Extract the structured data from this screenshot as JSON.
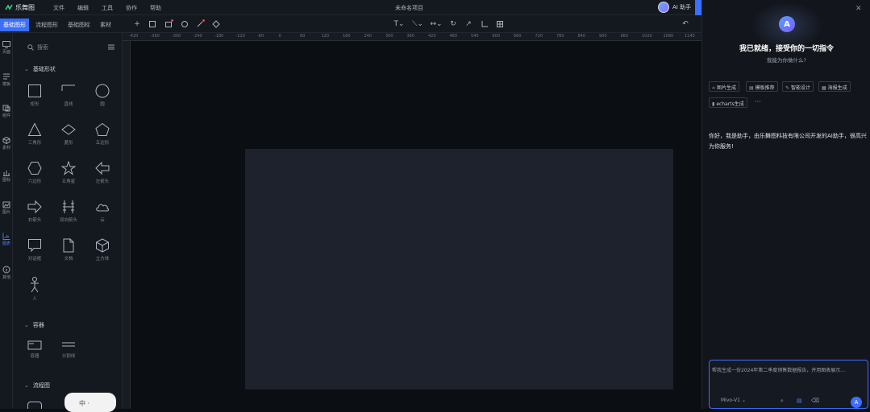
{
  "app": {
    "name": "乐舞图"
  },
  "menu": [
    "文件",
    "编辑",
    "工具",
    "协作",
    "帮助"
  ],
  "document": {
    "title": "未命名项目"
  },
  "ai_button": {
    "label": "AI 助手"
  },
  "tabs": [
    {
      "label": "基础图形",
      "active": true
    },
    {
      "label": "流程图形",
      "active": false
    },
    {
      "label": "基础图标",
      "active": false
    },
    {
      "label": "素材",
      "active": false
    }
  ],
  "toolbar": {
    "left_icons": [
      "plus-icon",
      "save-icon",
      "export-icon",
      "history-icon",
      "brush-icon",
      "fill-icon"
    ],
    "center_icons": [
      "text-icon",
      "line-icon",
      "arrow-style-icon",
      "rotate-icon",
      "pin-icon",
      "crop-icon",
      "grid-icon"
    ],
    "right_icons": [
      "undo-icon"
    ]
  },
  "rail": [
    {
      "label": "页面",
      "icon": "monitor-icon",
      "active": false
    },
    {
      "label": "模板",
      "icon": "document-icon",
      "active": false
    },
    {
      "label": "组件",
      "icon": "component-icon",
      "active": false
    },
    {
      "label": "素材",
      "icon": "cube-icon",
      "active": false
    },
    {
      "label": "图标",
      "icon": "chart-icon",
      "active": false
    },
    {
      "label": "图片",
      "icon": "image-icon",
      "active": false
    },
    {
      "label": "图表",
      "icon": "bar-chart-icon",
      "active": true
    },
    {
      "label": "其他",
      "icon": "info-icon",
      "active": false
    }
  ],
  "panel": {
    "search_placeholder": "搜索",
    "sections": [
      {
        "title": "基础形状",
        "shapes": [
          {
            "name": "rectangle-shape",
            "label": "矩形"
          },
          {
            "name": "line-shape",
            "label": "直线"
          },
          {
            "name": "circle-shape",
            "label": "圆"
          },
          {
            "name": "triangle-shape",
            "label": "三角形"
          },
          {
            "name": "diamond-shape",
            "label": "菱形"
          },
          {
            "name": "pentagon-shape",
            "label": "五边形"
          },
          {
            "name": "hexagon-shape",
            "label": "六边形"
          },
          {
            "name": "star-shape",
            "label": "五角星"
          },
          {
            "name": "left-arrow-shape",
            "label": "左箭头"
          },
          {
            "name": "right-arrow-shape",
            "label": "右箭头"
          },
          {
            "name": "double-arrow-shape",
            "label": "双向箭头"
          },
          {
            "name": "cloud-shape",
            "label": "云"
          },
          {
            "name": "callout-shape",
            "label": "对话框"
          },
          {
            "name": "document-shape",
            "label": "文档"
          },
          {
            "name": "cube-shape",
            "label": "立方体"
          },
          {
            "name": "person-shape",
            "label": "人"
          }
        ]
      },
      {
        "title": "容器",
        "shapes": [
          {
            "name": "container-shape",
            "label": "容器"
          },
          {
            "name": "divider-shape",
            "label": "分割线"
          }
        ]
      },
      {
        "title": "流程图",
        "shapes": []
      }
    ]
  },
  "ruler": [
    "-420",
    "-360",
    "-300",
    "-240",
    "-180",
    "-120",
    "-60",
    "0",
    "60",
    "120",
    "180",
    "240",
    "300",
    "360",
    "420",
    "480",
    "540",
    "600",
    "660",
    "720",
    "780",
    "840",
    "900",
    "960",
    "1020",
    "1080",
    "1140",
    "1200",
    "1260",
    "1320",
    "1380",
    "1440",
    "1500",
    "1560",
    "1620",
    "1680",
    "1740",
    "1800",
    "1860",
    "1920",
    "1980",
    "2040",
    "2100",
    "2160"
  ],
  "ai_panel": {
    "heading": "我已就绪，接受你的一切指令",
    "subheading": "我能为你做什么?",
    "chips": [
      {
        "icon": "⟡",
        "label": "图片生成"
      },
      {
        "icon": "▤",
        "label": "模板推荐"
      },
      {
        "icon": "✎",
        "label": "智能设计"
      },
      {
        "icon": "▦",
        "label": "海报生成"
      },
      {
        "icon": "▮",
        "label": "echarts生成"
      }
    ],
    "more": "···",
    "message": "你好，我是助手，由乐舞图科技有限公司开发的AI助手，很高兴为你服务!",
    "input_placeholder": "帮我生成一份2024年第二季度销售数据报告，并用图表展示...",
    "model": "Mivo-V1 ⌄"
  },
  "sticker": {
    "text": "中 ·"
  },
  "colors": {
    "accent": "#3b6fff",
    "background": "#0b0e13",
    "panel": "#14181f",
    "artboard": "#1e222c"
  }
}
